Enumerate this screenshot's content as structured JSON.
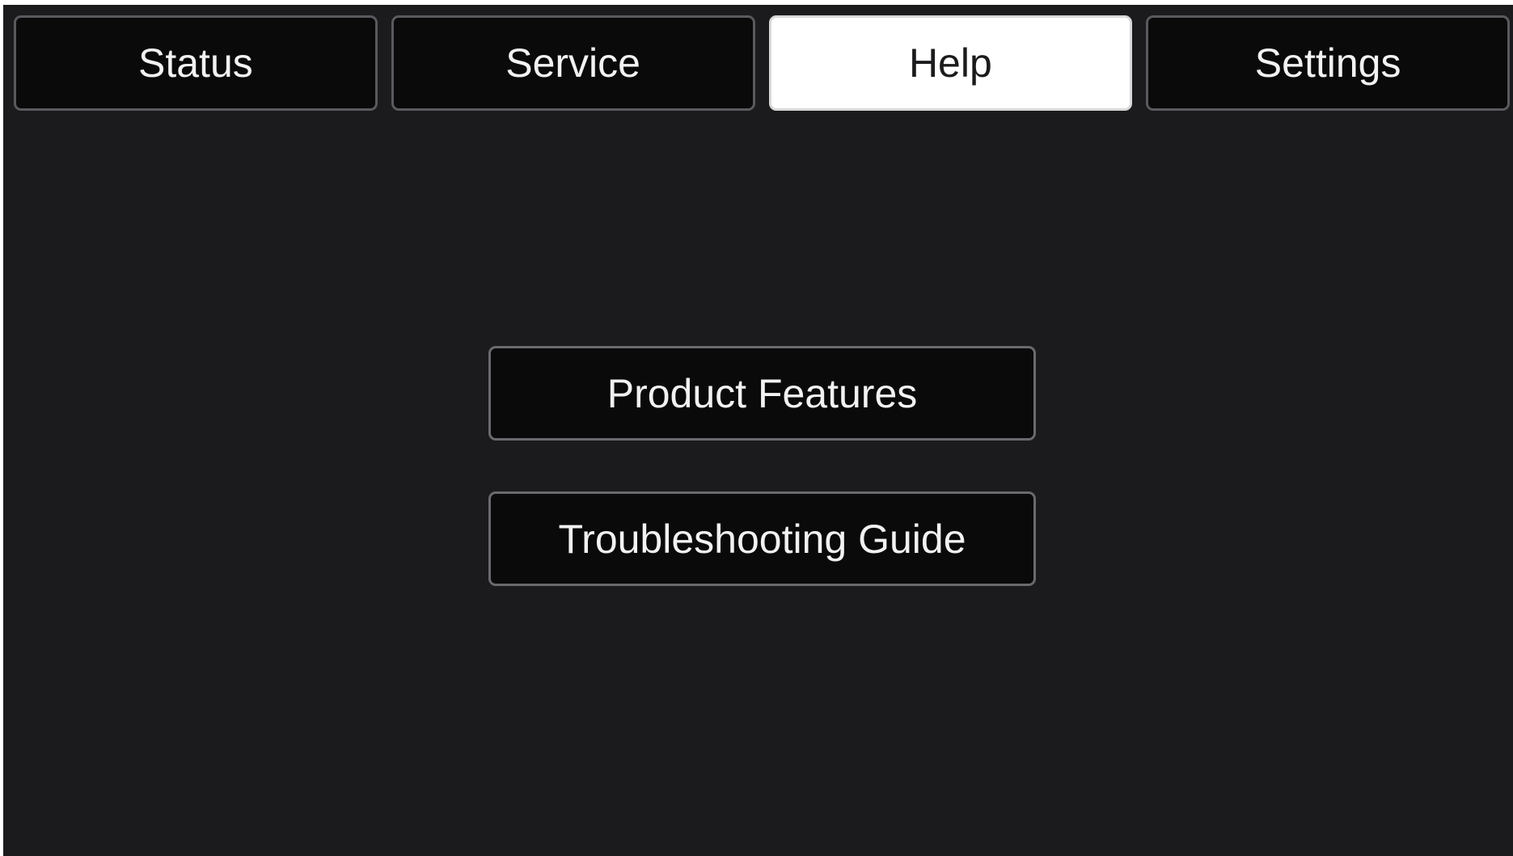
{
  "tabs": [
    {
      "label": "Status",
      "active": false
    },
    {
      "label": "Service",
      "active": false
    },
    {
      "label": "Help",
      "active": true
    },
    {
      "label": "Settings",
      "active": false
    }
  ],
  "help_menu": {
    "product_features_label": "Product Features",
    "troubleshooting_label": "Troubleshooting Guide"
  },
  "colors": {
    "background": "#1b1b1d",
    "button_fill": "#0a0a0b",
    "button_border": "#5a5a5e",
    "active_tab_fill": "#ffffff",
    "text": "#f2f2f2"
  }
}
